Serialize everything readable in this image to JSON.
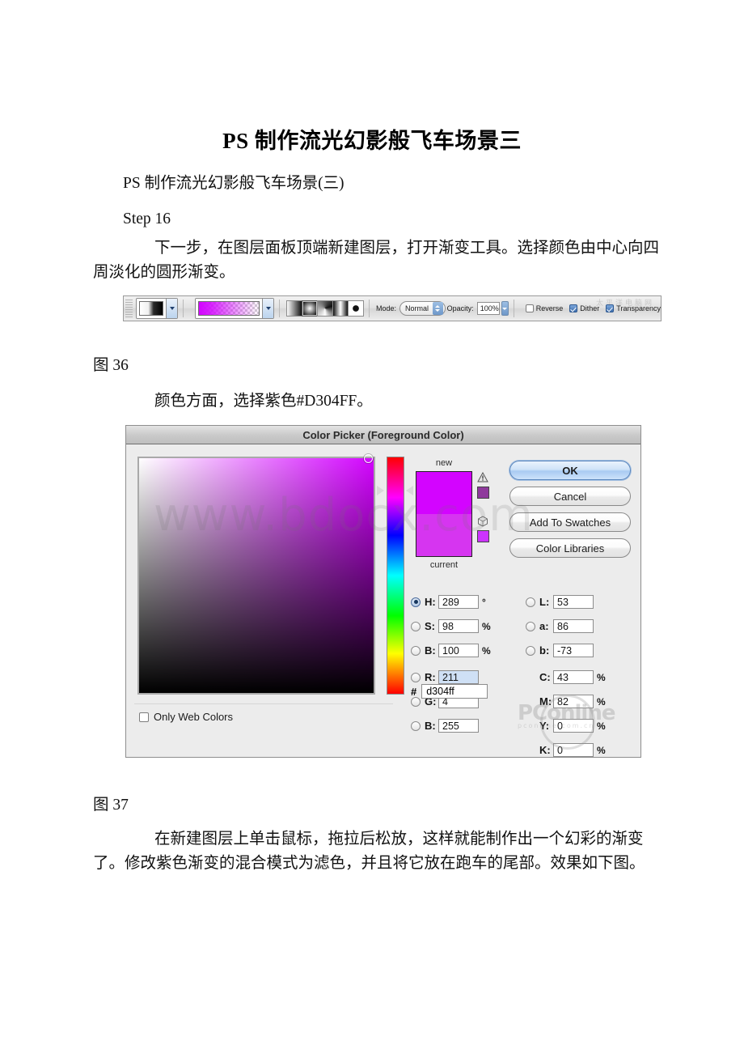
{
  "document": {
    "title": "PS 制作流光幻影般飞车场景三",
    "subtitle": "PS 制作流光幻影般飞车场景(三)",
    "step_heading": "Step 16",
    "paragraph_1": "下一步，在图层面板顶端新建图层，打开渐变工具。选择颜色由中心向四周淡化的圆形渐变。",
    "figure_36_caption": "图 36",
    "paragraph_2": "颜色方面，选择紫色#D304FF。",
    "figure_37_caption": "图 37",
    "paragraph_3": "在新建图层上单击鼠标，拖拉后松放，这样就能制作出一个幻彩的渐变了。修改紫色渐变的混合模式为滤色，并且将它放在跑车的尾部。效果如下图。"
  },
  "gradient_toolbar": {
    "mode_label": "Mode:",
    "mode_value": "Normal",
    "opacity_label": "Opacity:",
    "opacity_value": "100%",
    "reverse_label": "Reverse",
    "reverse_checked": false,
    "dither_label": "Dither",
    "dither_checked": true,
    "transparency_label": "Transparency",
    "transparency_checked": true,
    "gradient_preset_color": "#d304ff",
    "gradient_types": [
      "linear-gradient-icon",
      "radial-gradient-icon",
      "angle-gradient-icon",
      "reflected-gradient-icon",
      "diamond-gradient-icon"
    ],
    "selected_gradient_type": "radial-gradient-icon",
    "watermark": "太平洋电脑网"
  },
  "color_picker": {
    "title": "Color Picker (Foreground Color)",
    "new_label": "new",
    "current_label": "current",
    "buttons": {
      "ok": "OK",
      "cancel": "Cancel",
      "add_to_swatches": "Add To Swatches",
      "color_libraries": "Color Libraries"
    },
    "hsb": [
      {
        "label": "H:",
        "value": "289",
        "unit": "°",
        "selected": true
      },
      {
        "label": "S:",
        "value": "98",
        "unit": "%",
        "selected": false
      },
      {
        "label": "B:",
        "value": "100",
        "unit": "%",
        "selected": false
      }
    ],
    "rgb": [
      {
        "label": "R:",
        "value": "211",
        "unit": "",
        "selected": false,
        "highlight": true
      },
      {
        "label": "G:",
        "value": "4",
        "unit": "",
        "selected": false,
        "highlight": false
      },
      {
        "label": "B:",
        "value": "255",
        "unit": "",
        "selected": false,
        "highlight": false
      }
    ],
    "lab": [
      {
        "label": "L:",
        "value": "53",
        "unit": ""
      },
      {
        "label": "a:",
        "value": "86",
        "unit": ""
      },
      {
        "label": "b:",
        "value": "-73",
        "unit": ""
      }
    ],
    "cmyk": [
      {
        "label": "C:",
        "value": "43",
        "unit": "%"
      },
      {
        "label": "M:",
        "value": "82",
        "unit": "%"
      },
      {
        "label": "Y:",
        "value": "0",
        "unit": "%"
      },
      {
        "label": "K:",
        "value": "0",
        "unit": "%"
      }
    ],
    "hex_prefix": "#",
    "hex_value": "d304ff",
    "only_web_colors_label": "Only Web Colors",
    "only_web_colors_checked": false,
    "selected_color": "#d304ff",
    "current_color": "#d635f0",
    "out_of_gamut_alt_color": "#8f3a9c",
    "web_safe_alt_color": "#cc33ff"
  },
  "watermarks": {
    "site": "www.bdocx.com",
    "pconline_main": "PConline",
    "pconline_sub": "pconline.com.cn"
  }
}
